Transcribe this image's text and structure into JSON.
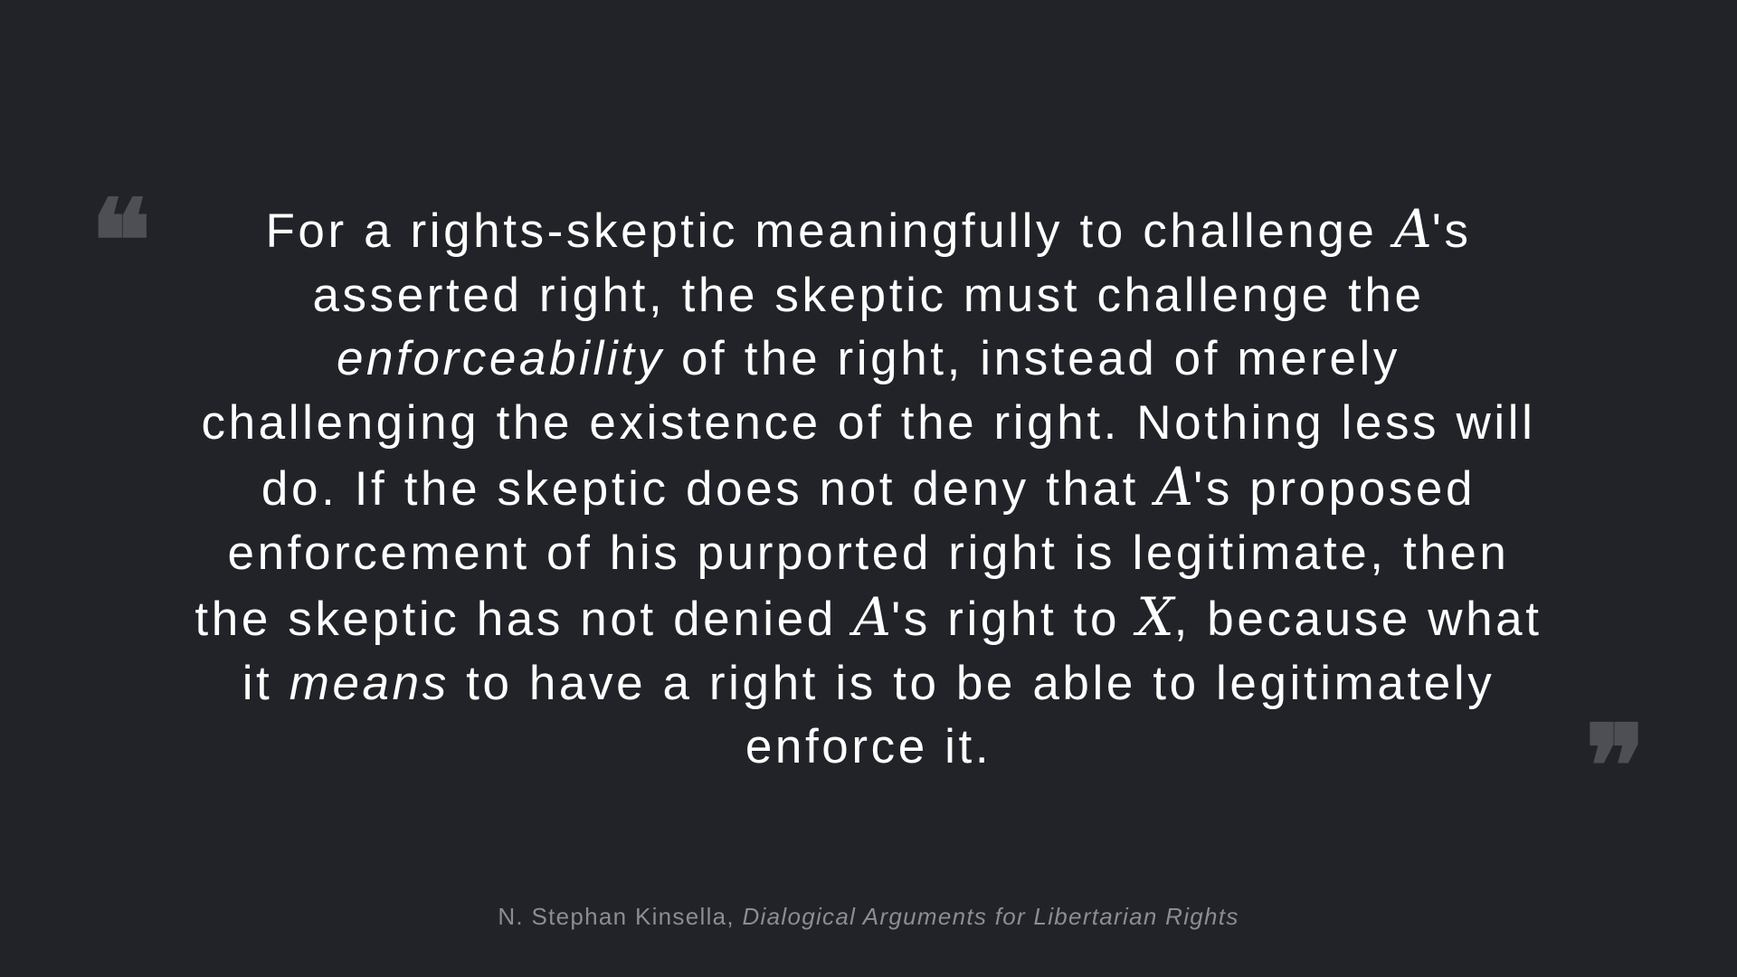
{
  "quote": {
    "open_mark": "❝",
    "close_mark": "❞",
    "segments": [
      {
        "text": "For a rights-skeptic meaningfully to challenge "
      },
      {
        "math": "A"
      },
      {
        "text": "'s asserted right, the skeptic must challenge the "
      },
      {
        "em": "enforceability"
      },
      {
        "text": " of the right, instead of merely challenging the existence of the right. Nothing less will do. If the skeptic does not deny that "
      },
      {
        "math": "A"
      },
      {
        "text": "'s proposed enforcement of his purported right is legitimate, then the skeptic has not denied "
      },
      {
        "math": "A"
      },
      {
        "text": "'s right to "
      },
      {
        "math": "X"
      },
      {
        "text": ", because what it "
      },
      {
        "em": "means"
      },
      {
        "text": " to have a right is to be able to legitimately enforce it."
      }
    ]
  },
  "attribution": {
    "author": "N. Stephan Kinsella, ",
    "work": "Dialogical Arguments for Libertarian Rights"
  },
  "colors": {
    "background": "#222328",
    "quote_text": "#ffffff",
    "quote_marks": "#4e4f54",
    "attribution": "#8c8d92"
  }
}
